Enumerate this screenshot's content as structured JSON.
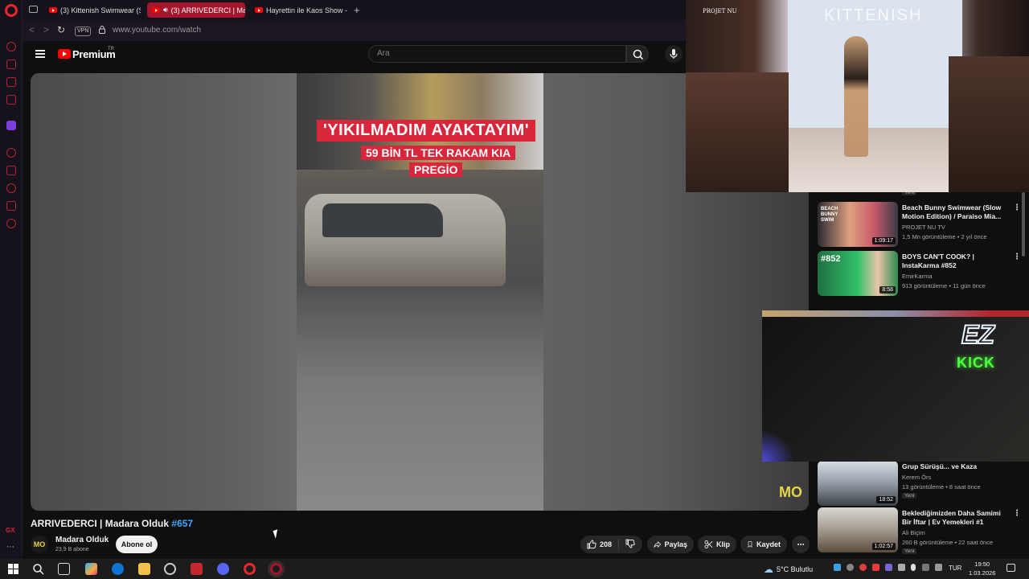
{
  "browser": {
    "tabs": [
      {
        "label": "(3) Kittenish Swimwear (S",
        "active": false
      },
      {
        "label": "(3) ARRIVEDERCI | Ma",
        "active": true
      },
      {
        "label": "Hayrettin ile Kaos Show - ",
        "active": false
      }
    ],
    "vpn_label": "VPN",
    "url": "www.youtube.com/watch"
  },
  "youtube": {
    "brand": "Premium",
    "region": "TR",
    "search_placeholder": "Ara"
  },
  "video": {
    "caption_line1": "'YIKILMADIM AYAKTAYIM'",
    "caption_line2": "59 BİN TL TEK RAKAM KIA",
    "caption_line3": "PREGİO",
    "watermark": "MO",
    "title": "ARRIVEDERCI | Madara Olduk",
    "title_hashtag": "#657",
    "channel_name": "Madara Olduk",
    "channel_avatar": "MO",
    "subscribers": "23,9 B abone",
    "subscribe_label": "Abone ol",
    "likes": "208",
    "share_label": "Paylaş",
    "clip_label": "Klip",
    "save_label": "Kaydet"
  },
  "recommendations": [
    {
      "title": "Beach Bunny Swimwear (Slow Motion Edition) / Paraiso Mia...",
      "channel": "PROJET NU TV",
      "meta": "1,5 Mn görüntüleme • 2 yıl önce",
      "duration": "1:09:17",
      "badge": ""
    },
    {
      "title": "BOYS CAN'T COOK? | InstaKarma #852",
      "channel": "EmirKarma",
      "meta": "913 görüntüleme • 11 gün önce",
      "duration": "8:58",
      "badge": ""
    },
    {
      "title": "Grup Sürüşü... ve Kaza",
      "channel": "Kerem Örs",
      "meta": "13 görüntüleme • 8 saat önce",
      "duration": "18:52",
      "badge": "Yeni"
    },
    {
      "title": "Beklediğimizden Daha Samimi Bir İftar | Ev Yemekleri #1",
      "channel": "Ali Biçim",
      "meta": "260 B görüntüleme • 22 saat önce",
      "duration": "1:02:57",
      "badge": "Yeni"
    }
  ],
  "top_partial_badge": "Yeni",
  "overlays": {
    "runway_brand": "KITTENISH",
    "runway_tag": "PROJET NU",
    "cam_sign_1": "EZ",
    "cam_sign_2": "KICK"
  },
  "taskbar": {
    "weather": "5°C  Bulutlu",
    "language": "TUR",
    "time": "19:50",
    "date": "1.03.2026"
  },
  "colors": {
    "accent_opera": "#d92637",
    "youtube_red": "#ff0000",
    "hashtag_blue": "#3ea6ff"
  }
}
